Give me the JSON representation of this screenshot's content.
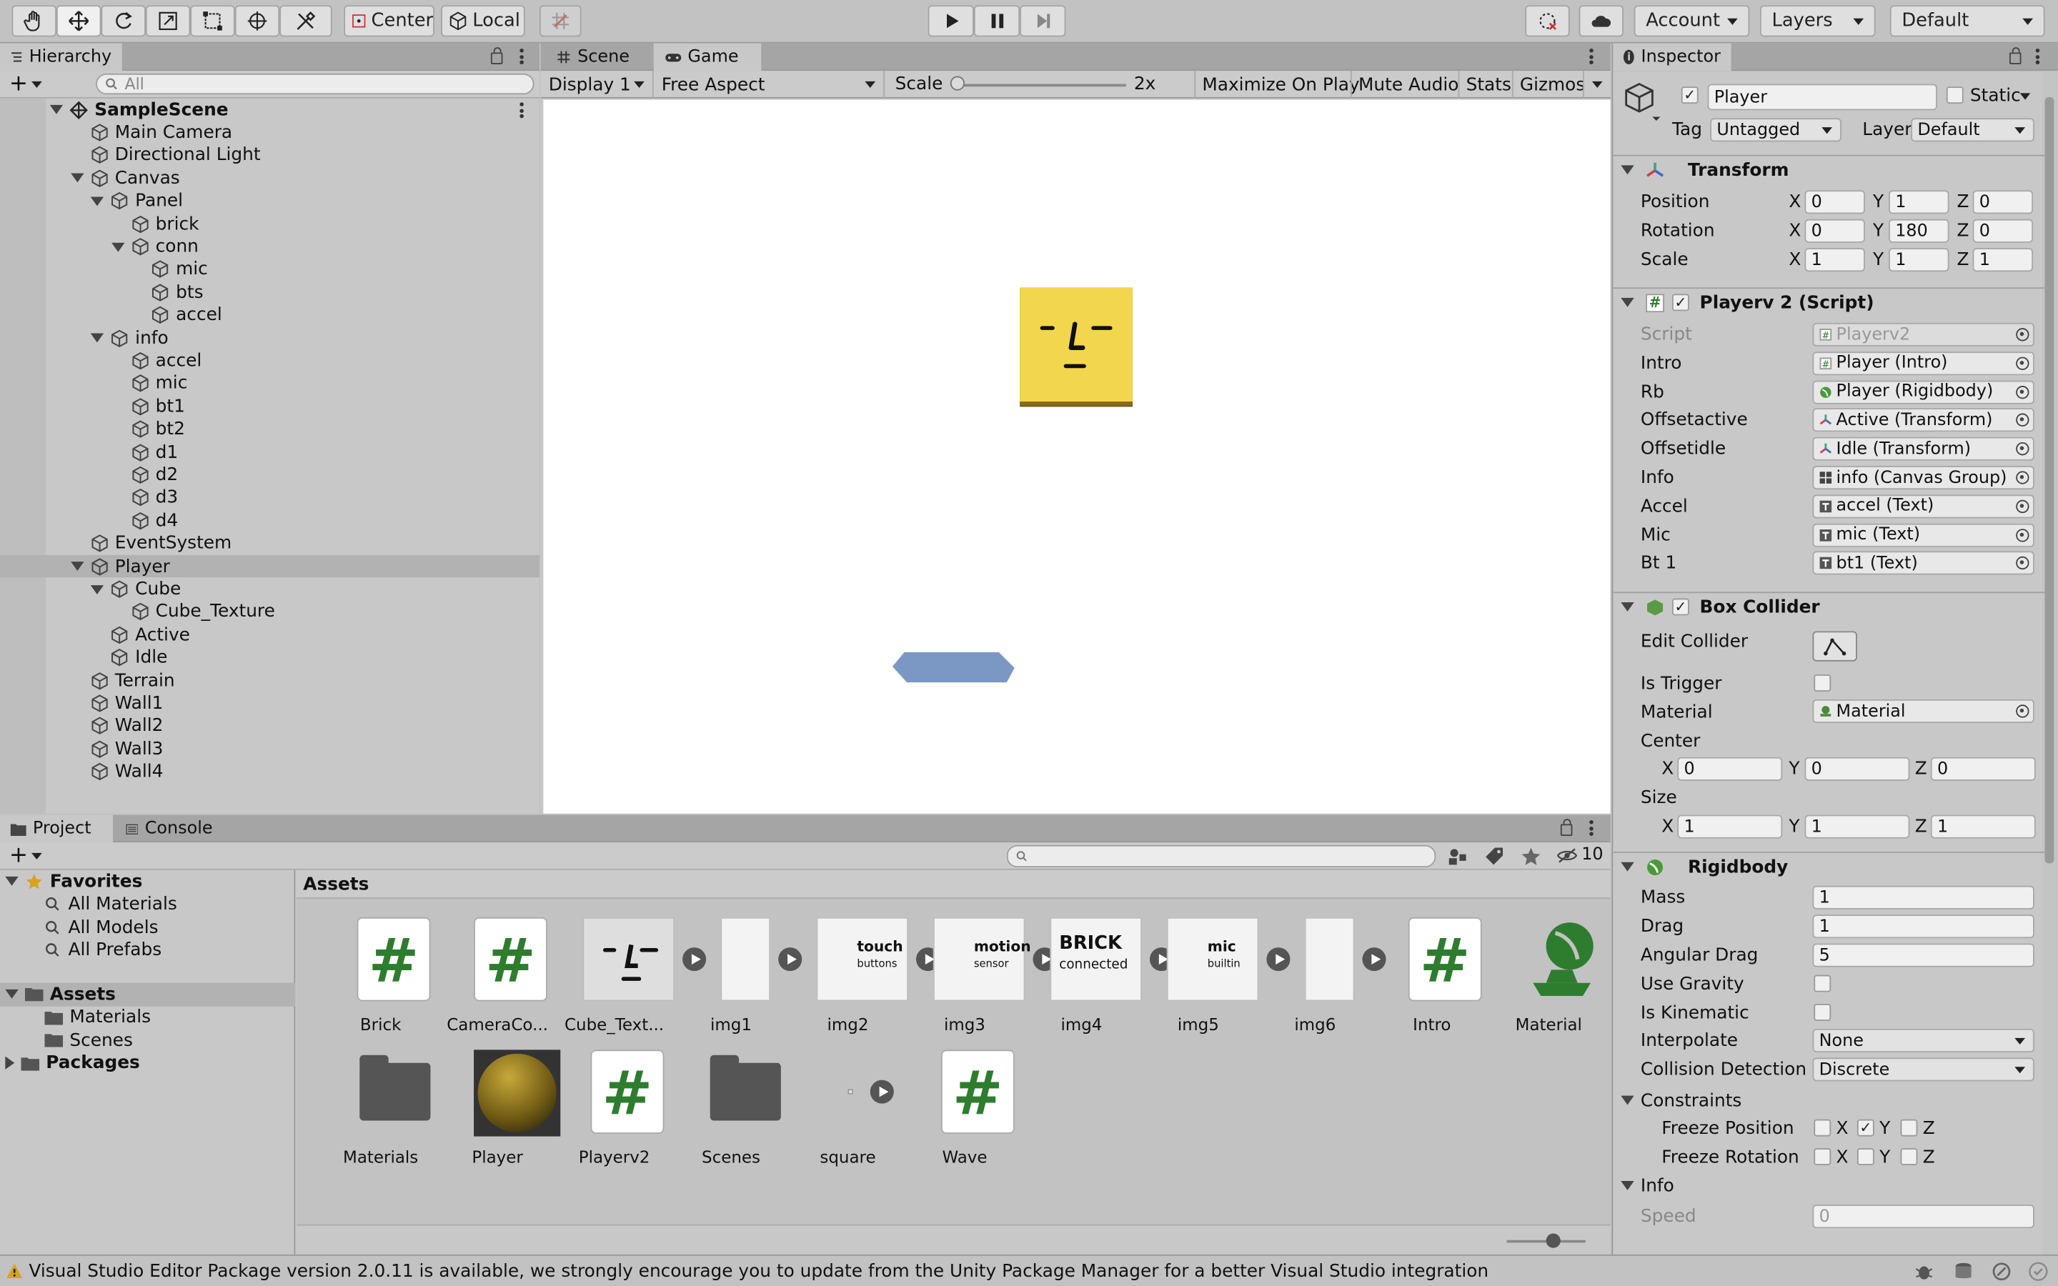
{
  "toolbar": {
    "pivot_mode": "Center",
    "pivot_rotation": "Local",
    "account": "Account",
    "layers": "Layers",
    "layout": "Default",
    "tool_icons": [
      "hand-icon",
      "move-icon",
      "rotate-icon",
      "scale-icon",
      "rect-icon",
      "transform-icon",
      "custom-tool-icon"
    ]
  },
  "hierarchy": {
    "tab": "Hierarchy",
    "search_placeholder": "All",
    "items": [
      {
        "label": "SampleScene",
        "depth": 0,
        "expanded": true,
        "scene": true
      },
      {
        "label": "Main Camera",
        "depth": 1
      },
      {
        "label": "Directional Light",
        "depth": 1
      },
      {
        "label": "Canvas",
        "depth": 1,
        "expanded": true
      },
      {
        "label": "Panel",
        "depth": 2,
        "expanded": true
      },
      {
        "label": "brick",
        "depth": 3
      },
      {
        "label": "conn",
        "depth": 3,
        "expanded": true
      },
      {
        "label": "mic",
        "depth": 4
      },
      {
        "label": "bts",
        "depth": 4
      },
      {
        "label": "accel",
        "depth": 4
      },
      {
        "label": "info",
        "depth": 2,
        "expanded": true
      },
      {
        "label": "accel",
        "depth": 3
      },
      {
        "label": "mic",
        "depth": 3
      },
      {
        "label": "bt1",
        "depth": 3
      },
      {
        "label": "bt2",
        "depth": 3
      },
      {
        "label": "d1",
        "depth": 3
      },
      {
        "label": "d2",
        "depth": 3
      },
      {
        "label": "d3",
        "depth": 3
      },
      {
        "label": "d4",
        "depth": 3
      },
      {
        "label": "EventSystem",
        "depth": 1
      },
      {
        "label": "Player",
        "depth": 1,
        "expanded": true,
        "selected": true
      },
      {
        "label": "Cube",
        "depth": 2,
        "expanded": true
      },
      {
        "label": "Cube_Texture",
        "depth": 3
      },
      {
        "label": "Active",
        "depth": 2
      },
      {
        "label": "Idle",
        "depth": 2
      },
      {
        "label": "Terrain",
        "depth": 1
      },
      {
        "label": "Wall1",
        "depth": 1
      },
      {
        "label": "Wall2",
        "depth": 1
      },
      {
        "label": "Wall3",
        "depth": 1
      },
      {
        "label": "Wall4",
        "depth": 1
      }
    ]
  },
  "game": {
    "tabs": [
      "Scene",
      "Game"
    ],
    "display": "Display 1",
    "aspect": "Free Aspect",
    "scale_label": "Scale",
    "scale_value": "2x",
    "maximize": "Maximize On Play",
    "mute": "Mute Audio",
    "stats": "Stats",
    "gizmos": "Gizmos"
  },
  "inspector": {
    "tab": "Inspector",
    "object_name": "Player",
    "static_label": "Static",
    "tag_label": "Tag",
    "tag_value": "Untagged",
    "layer_label": "Layer",
    "layer_value": "Default",
    "transform": {
      "title": "Transform",
      "position_label": "Position",
      "rotation_label": "Rotation",
      "scale_label": "Scale",
      "position": [
        "0",
        "1",
        "0"
      ],
      "rotation": [
        "0",
        "180",
        "0"
      ],
      "scale": [
        "1",
        "1",
        "1"
      ],
      "axes": [
        "X",
        "Y",
        "Z"
      ]
    },
    "script": {
      "title": "Playerv 2 (Script)",
      "fields": [
        {
          "label": "Script",
          "value": "Playerv2",
          "icon": "script"
        },
        {
          "label": "Intro",
          "value": "Player (Intro)",
          "icon": "script"
        },
        {
          "label": "Rb",
          "value": "Player (Rigidbody)",
          "icon": "rigidbody"
        },
        {
          "label": "Offsetactive",
          "value": "Active (Transform)",
          "icon": "transform"
        },
        {
          "label": "Offsetidle",
          "value": "Idle (Transform)",
          "icon": "transform"
        },
        {
          "label": "Info",
          "value": "info (Canvas Group)",
          "icon": "canvas-group"
        },
        {
          "label": "Accel",
          "value": "accel (Text)",
          "icon": "text"
        },
        {
          "label": "Mic",
          "value": "mic (Text)",
          "icon": "text"
        },
        {
          "label": "Bt 1",
          "value": "bt1 (Text)",
          "icon": "text"
        }
      ]
    },
    "box_collider": {
      "title": "Box Collider",
      "edit_label": "Edit Collider",
      "trigger_label": "Is Trigger",
      "material_label": "Material",
      "material_value": "Material",
      "center_label": "Center",
      "center": [
        "0",
        "0",
        "0"
      ],
      "size_label": "Size",
      "size": [
        "1",
        "1",
        "1"
      ]
    },
    "rigidbody": {
      "title": "Rigidbody",
      "mass_label": "Mass",
      "mass": "1",
      "drag_label": "Drag",
      "drag": "1",
      "angular_label": "Angular Drag",
      "angular": "5",
      "gravity_label": "Use Gravity",
      "kinematic_label": "Is Kinematic",
      "interpolate_label": "Interpolate",
      "interpolate": "None",
      "collision_label": "Collision Detection",
      "collision": "Discrete",
      "constraints_label": "Constraints",
      "freeze_pos_label": "Freeze Position",
      "freeze_rot_label": "Freeze Rotation",
      "freeze_pos": [
        false,
        true,
        false
      ],
      "freeze_rot": [
        false,
        false,
        false
      ]
    },
    "info_label": "Info",
    "speed_label": "Speed",
    "speed_value": "0"
  },
  "project": {
    "tabs": [
      "Project",
      "Console"
    ],
    "hidden_count": "10",
    "favorites": "Favorites",
    "fav_items": [
      "All Materials",
      "All Models",
      "All Prefabs"
    ],
    "assets_label": "Assets",
    "asset_folders": [
      "Materials",
      "Scenes"
    ],
    "packages": "Packages",
    "breadcrumb": "Assets",
    "assets_row1": [
      "Brick",
      "CameraCo...",
      "Cube_Text...",
      "img1",
      "img2",
      "img3",
      "img4",
      "img5",
      "img6",
      "Intro",
      "Material"
    ],
    "assets_row2": [
      "Materials",
      "Player",
      "Playerv2",
      "Scenes",
      "square",
      "Wave"
    ],
    "thumb_text": {
      "img2": "touch",
      "img2b": "buttons",
      "img3": "motion",
      "img3b": "sensor",
      "img4": "BRICK",
      "img4b": "connected",
      "img5": "mic",
      "img5b": "builtin"
    }
  },
  "status_bar": "Visual Studio Editor Package version 2.0.11 is available, we strongly encourage you to update from the Unity Package Manager for a better Visual Studio integration",
  "colors": {
    "selection": "#b2b2b2",
    "green": "#2e7d2e",
    "yellow_cube": "#f2d64d",
    "platform": "#6d8dbf"
  }
}
